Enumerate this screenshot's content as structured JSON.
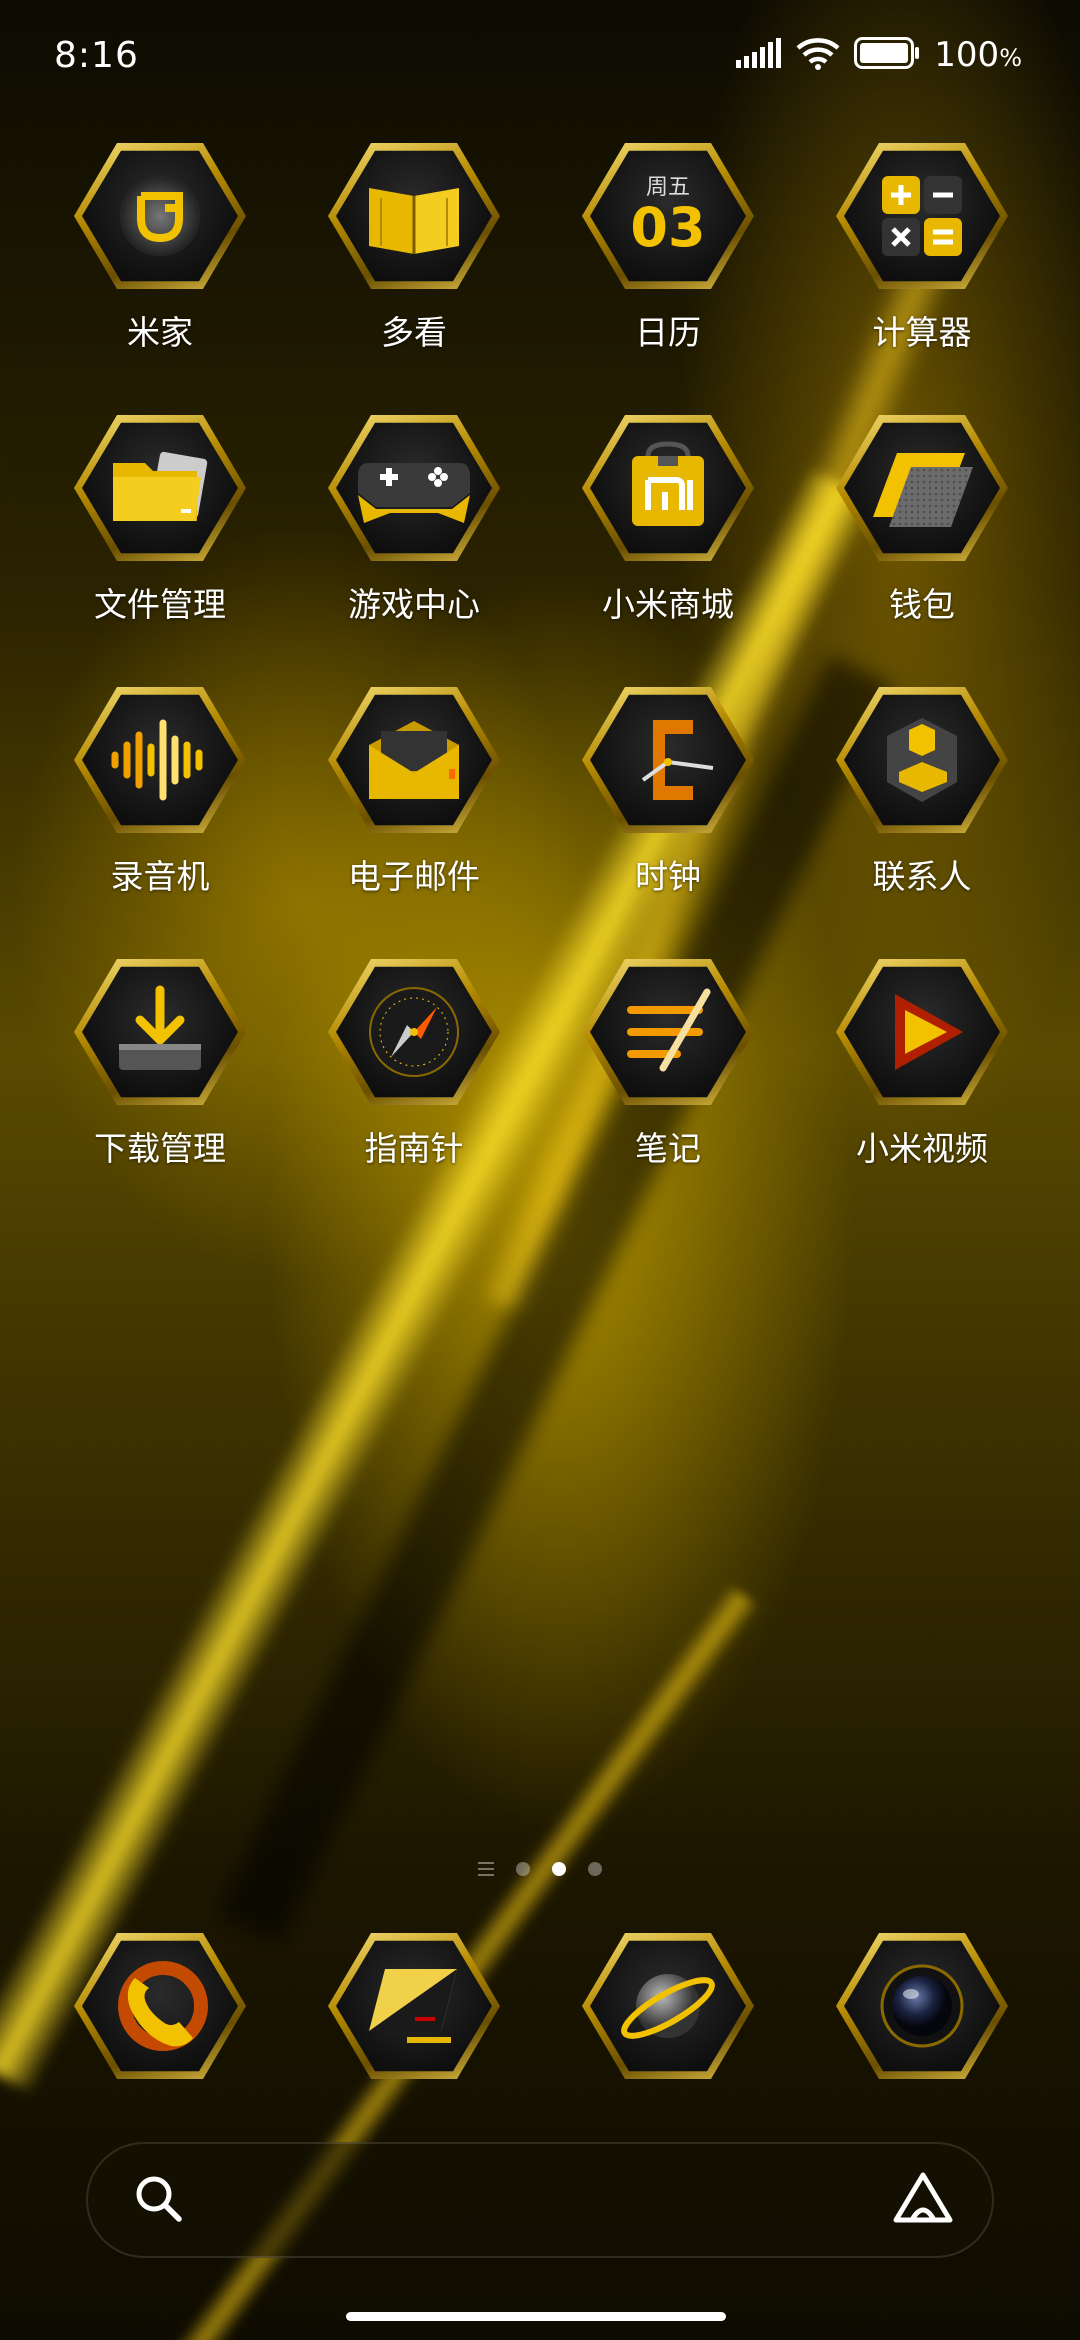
{
  "status_bar": {
    "time": "8:16",
    "battery_percent": "100",
    "battery_unit": "%",
    "signal_icon": "cellular-signal-icon",
    "wifi_icon": "wifi-icon",
    "battery_icon": "battery-icon"
  },
  "apps": [
    {
      "label": "米家",
      "icon": "mijia-icon"
    },
    {
      "label": "多看",
      "icon": "book-icon"
    },
    {
      "label": "日历",
      "icon": "calendar-icon",
      "weekday": "周五",
      "day": "03"
    },
    {
      "label": "计算器",
      "icon": "calculator-icon"
    },
    {
      "label": "文件管理",
      "icon": "folder-icon"
    },
    {
      "label": "游戏中心",
      "icon": "gamepad-icon"
    },
    {
      "label": "小米商城",
      "icon": "shopping-bag-icon",
      "badge": "mi"
    },
    {
      "label": "钱包",
      "icon": "wallet-icon"
    },
    {
      "label": "录音机",
      "icon": "waveform-icon"
    },
    {
      "label": "电子邮件",
      "icon": "envelope-icon"
    },
    {
      "label": "时钟",
      "icon": "clock-icon"
    },
    {
      "label": "联系人",
      "icon": "contact-icon"
    },
    {
      "label": "下载管理",
      "icon": "download-icon"
    },
    {
      "label": "指南针",
      "icon": "compass-icon"
    },
    {
      "label": "笔记",
      "icon": "notes-icon"
    },
    {
      "label": "小米视频",
      "icon": "play-icon"
    }
  ],
  "page_indicator": {
    "pages": 3,
    "active_page": 2
  },
  "dock": [
    {
      "icon": "phone-icon"
    },
    {
      "icon": "messages-icon"
    },
    {
      "icon": "browser-planet-icon"
    },
    {
      "icon": "camera-icon"
    }
  ],
  "search_bar": {
    "search_icon": "search-icon",
    "assistant_icon": "assistant-icon"
  },
  "colors": {
    "accent": "#f2c200",
    "hex_border": "#d4aa20",
    "background": "#2a2200"
  }
}
